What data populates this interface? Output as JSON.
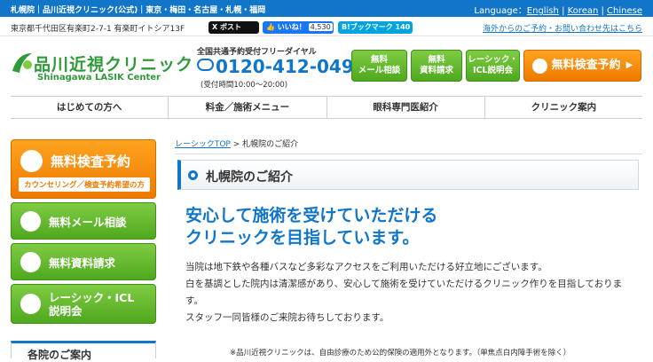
{
  "topbar": {
    "title": "札幌院｜品川近視クリニック(公式)｜東京・梅田・名古屋・札幌・福岡",
    "language_label": "Language：",
    "languages": [
      "English",
      "Korean",
      "Chinese"
    ]
  },
  "subbar": {
    "address": "東京都千代田区有楽町2-7-1 有楽町イトシア13F",
    "x_post": "X ポスト",
    "fb_like": "いいね！",
    "fb_count": "4,530",
    "hatena": "ブックマーク",
    "hatena_count": "140",
    "overseas_link": "海外からのご予約・お問い合わせ先はこちら"
  },
  "header": {
    "logo_jp": "品川近視クリニック",
    "logo_en": "Shinagawa LASIK Center",
    "tel_label": "全国共通予約受付フリーダイヤル",
    "tel_number": "0120-412-049",
    "tel_hours": "(受付時間10:00～20:00)",
    "buttons": [
      "無料\nメール相談",
      "無料\n資料請求",
      "レーシック・\nICL説明会"
    ],
    "exam_button": "無料検査予約"
  },
  "nav": {
    "items": [
      "はじめての方へ",
      "料金／施術メニュー",
      "眼科専門医紹介",
      "クリニック案内"
    ]
  },
  "sidebar": {
    "exam_button": "無料検査予約",
    "exam_sub": "カウンセリング／検査予約希望の方",
    "mail": "無料メール相談",
    "docs": "無料資料請求",
    "seminar": "レーシック・ICL\n説明会",
    "clinic_guide": "各院のご案内"
  },
  "main": {
    "crumb_home": "レーシックTOP",
    "crumb_sep": " > ",
    "crumb_current": "札幌院のご紹介",
    "page_title": "札幌院のご紹介",
    "headline_1": "安心して施術を受けていただける",
    "headline_2": "クリニックを目指しています。",
    "body_1": "当院は地下鉄や各種バスなど多彩なアクセスをご利用いただける好立地にございます。",
    "body_2": "白を基調とした院内は清潔感があり、安心して施術を受けていただけるクリニック作りを目指しておりま",
    "body_3": "す。",
    "body_4": "スタッフ一同皆様のご来院お待ちしております。",
    "note": "※品川近視クリニックは、自由診療のため公的保険の適用外となります。（単焦点白内障手術を除く）"
  },
  "colors": {
    "brand_blue": "#1276c8",
    "brand_green": "#2e9b3a",
    "cta_orange": "#ee7a00",
    "button_green": "#4ea81e"
  },
  "icons": [
    "search-icon",
    "mail-icon",
    "document-icon",
    "presentation-icon",
    "phone-icon"
  ]
}
